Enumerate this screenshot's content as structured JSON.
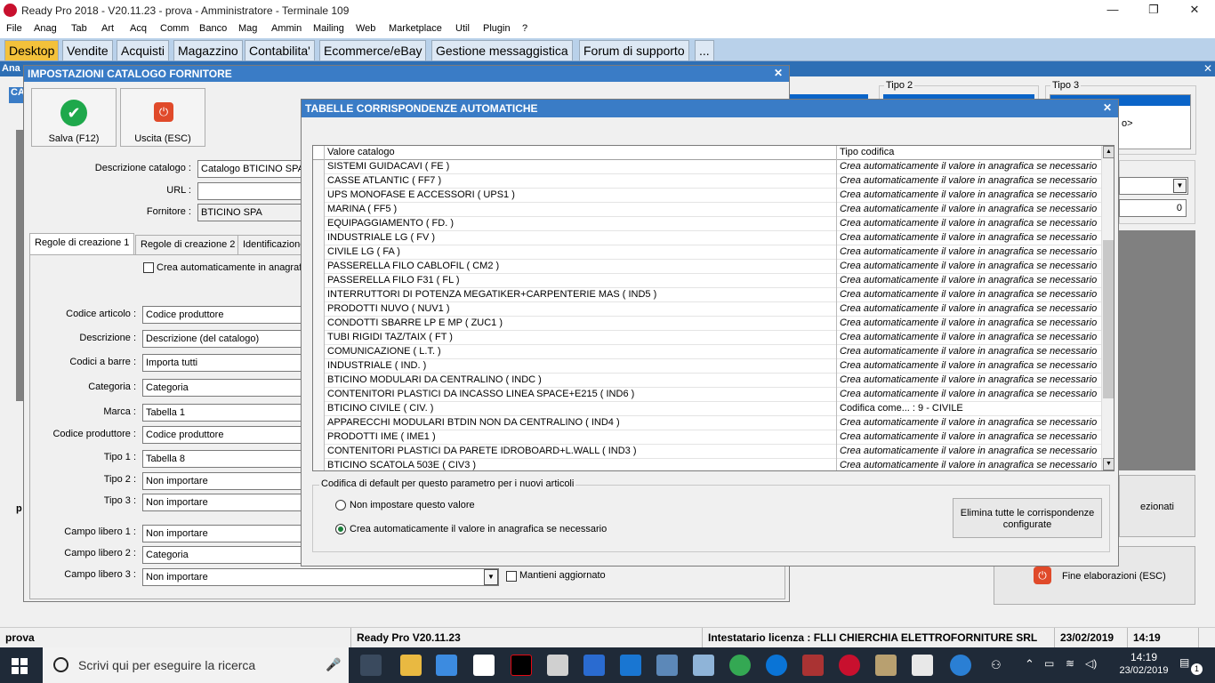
{
  "window": {
    "title": "Ready Pro 2018 - V20.11.23 - prova - Amministratore - Terminale 109",
    "minimize": "—",
    "restore": "❐",
    "close": "✕"
  },
  "menu": [
    "File",
    "Anag",
    "Tab",
    "Art",
    "Acq",
    "Comm",
    "Banco",
    "Mag",
    "Ammin",
    "Mailing",
    "Web",
    "Marketplace",
    "Util",
    "Plugin",
    "?"
  ],
  "module_tabs": [
    "Desktop",
    "Vendite",
    "Acquisti",
    "Magazzino",
    "Contabilita'",
    "Ecommerce/eBay",
    "Gestione messaggistica",
    "Forum di supporto",
    "..."
  ],
  "active_tab": "Desktop",
  "background": {
    "header_text": "Ana",
    "sub_header": "CA",
    "tipo2": "Tipo 2",
    "tipo3": "Tipo 3",
    "tipo3_fragment": "o>",
    "num_value": "0",
    "p_label": "p",
    "side_btn_text": "ezionati",
    "fine_btn": "Fine elaborazioni (ESC)"
  },
  "dialog1": {
    "title": "IMPOSTAZIONI CATALOGO FORNITORE",
    "save_label": "Salva (F12)",
    "exit_label": "Uscita (ESC)",
    "desc_label": "Descrizione catalogo :",
    "desc_value": "Catalogo BTICINO SPA",
    "url_label": "URL :",
    "url_value": "",
    "supplier_label": "Fornitore :",
    "supplier_value": "BTICINO SPA",
    "tabs": [
      "Regole di creazione 1",
      "Regole di creazione 2",
      "Identificazione"
    ],
    "auto_create_label": "Crea automaticamente in anagrafi",
    "fields": [
      {
        "label": "Codice articolo :",
        "value": "Codice produttore"
      },
      {
        "label": "Descrizione :",
        "value": "Descrizione (del catalogo)"
      },
      {
        "label": "Codici a barre :",
        "value": "Importa tutti"
      },
      {
        "label": "Categoria :",
        "value": "Categoria"
      },
      {
        "label": "Marca :",
        "value": "Tabella 1"
      },
      {
        "label": "Codice produttore :",
        "value": "Codice produttore"
      },
      {
        "label": "Tipo 1 :",
        "value": "Tabella 8"
      },
      {
        "label": "Tipo 2 :",
        "value": "Non importare"
      },
      {
        "label": "Tipo 3 :",
        "value": "Non importare"
      },
      {
        "label": "Campo libero 1 :",
        "value": "Non importare"
      },
      {
        "label": "Campo libero 2 :",
        "value": "Categoria"
      },
      {
        "label": "Campo libero 3 :",
        "value": "Non importare"
      }
    ],
    "keep_updated_label": "Mantieni aggiornato"
  },
  "dialog2": {
    "title": "TABELLE CORRISPONDENZE AUTOMATICHE",
    "col_catalog": "Valore catalogo",
    "col_type": "Tipo codifica",
    "rows": [
      {
        "v": "SISTEMI GUIDACAVI ( FE )",
        "t": "Crea automaticamente il valore in anagrafica se necessario",
        "i": true
      },
      {
        "v": "CASSE ATLANTIC ( FF7 )",
        "t": "Crea automaticamente il valore in anagrafica se necessario",
        "i": true
      },
      {
        "v": "UPS MONOFASE E ACCESSORI ( UPS1 )",
        "t": "Crea automaticamente il valore in anagrafica se necessario",
        "i": true
      },
      {
        "v": "MARINA ( FF5 )",
        "t": "Crea automaticamente il valore in anagrafica se necessario",
        "i": true
      },
      {
        "v": "EQUIPAGGIAMENTO ( FD. )",
        "t": "Crea automaticamente il valore in anagrafica se necessario",
        "i": true
      },
      {
        "v": "INDUSTRIALE LG ( FV )",
        "t": "Crea automaticamente il valore in anagrafica se necessario",
        "i": true
      },
      {
        "v": "CIVILE LG ( FA )",
        "t": "Crea automaticamente il valore in anagrafica se necessario",
        "i": true
      },
      {
        "v": "PASSERELLA FILO CABLOFIL ( CM2 )",
        "t": "Crea automaticamente il valore in anagrafica se necessario",
        "i": true
      },
      {
        "v": "PASSERELLA FILO F31 ( FL )",
        "t": "Crea automaticamente il valore in anagrafica se necessario",
        "i": true
      },
      {
        "v": "INTERRUTTORI DI POTENZA MEGATIKER+CARPENTERIE MAS ( IND5 )",
        "t": "Crea automaticamente il valore in anagrafica se necessario",
        "i": true
      },
      {
        "v": "PRODOTTI NUVO ( NUV1 )",
        "t": "Crea automaticamente il valore in anagrafica se necessario",
        "i": true
      },
      {
        "v": "CONDOTTI SBARRE LP E MP ( ZUC1 )",
        "t": "Crea automaticamente il valore in anagrafica se necessario",
        "i": true
      },
      {
        "v": "TUBI RIGIDI TAZ/TAIX ( FT )",
        "t": "Crea automaticamente il valore in anagrafica se necessario",
        "i": true
      },
      {
        "v": "COMUNICAZIONE ( L.T. )",
        "t": "Crea automaticamente il valore in anagrafica se necessario",
        "i": true
      },
      {
        "v": "INDUSTRIALE ( IND. )",
        "t": "Crea automaticamente il valore in anagrafica se necessario",
        "i": true
      },
      {
        "v": "BTICINO MODULARI DA CENTRALINO ( INDC )",
        "t": "Crea automaticamente il valore in anagrafica se necessario",
        "i": true
      },
      {
        "v": "CONTENITORI PLASTICI DA INCASSO LINEA SPACE+E215 ( IND6 )",
        "t": "Crea automaticamente il valore in anagrafica se necessario",
        "i": true
      },
      {
        "v": "BTICINO CIVILE ( CIV. )",
        "t": "Codifica come... : 9 - CIVILE",
        "i": false
      },
      {
        "v": "APPARECCHI MODULARI BTDIN NON DA CENTRALINO ( IND4 )",
        "t": "Crea automaticamente il valore in anagrafica se necessario",
        "i": true
      },
      {
        "v": "PRODOTTI IME ( IME1 )",
        "t": "Crea automaticamente il valore in anagrafica se necessario",
        "i": true
      },
      {
        "v": "CONTENITORI PLASTICI DA PARETE IDROBOARD+L.WALL ( IND3 )",
        "t": "Crea automaticamente il valore in anagrafica se necessario",
        "i": true
      },
      {
        "v": "BTICINO SCATOLA 503E ( CIV3 )",
        "t": "Crea automaticamente il valore in anagrafica se necessario",
        "i": true
      }
    ],
    "default_group_title": "Codifica di default per questo parametro per i nuovi articoli",
    "radio_none": "Non impostare questo valore",
    "radio_auto": "Crea automaticamente il valore in anagrafica se necessario",
    "radio_selected": "auto",
    "delete_btn_line1": "Elimina tutte le corrispondenze",
    "delete_btn_line2": "configurate"
  },
  "statusbar": {
    "db": "prova",
    "version": "Ready Pro V20.11.23",
    "license": "Intestatario licenza : FLLI CHIERCHIA ELETTROFORNITURE SRL",
    "date": "23/02/2019",
    "time": "14:19"
  },
  "taskbar": {
    "search_placeholder": "Scrivi qui per eseguire la ricerca",
    "clock_time": "14:19",
    "clock_date": "23/02/2019",
    "notifications": "1"
  },
  "colors": {
    "accent_blue": "#3a7cc6",
    "active_tab": "#f3c13b",
    "check_green": "#1ea84b",
    "exit_red": "#e04a2a"
  }
}
